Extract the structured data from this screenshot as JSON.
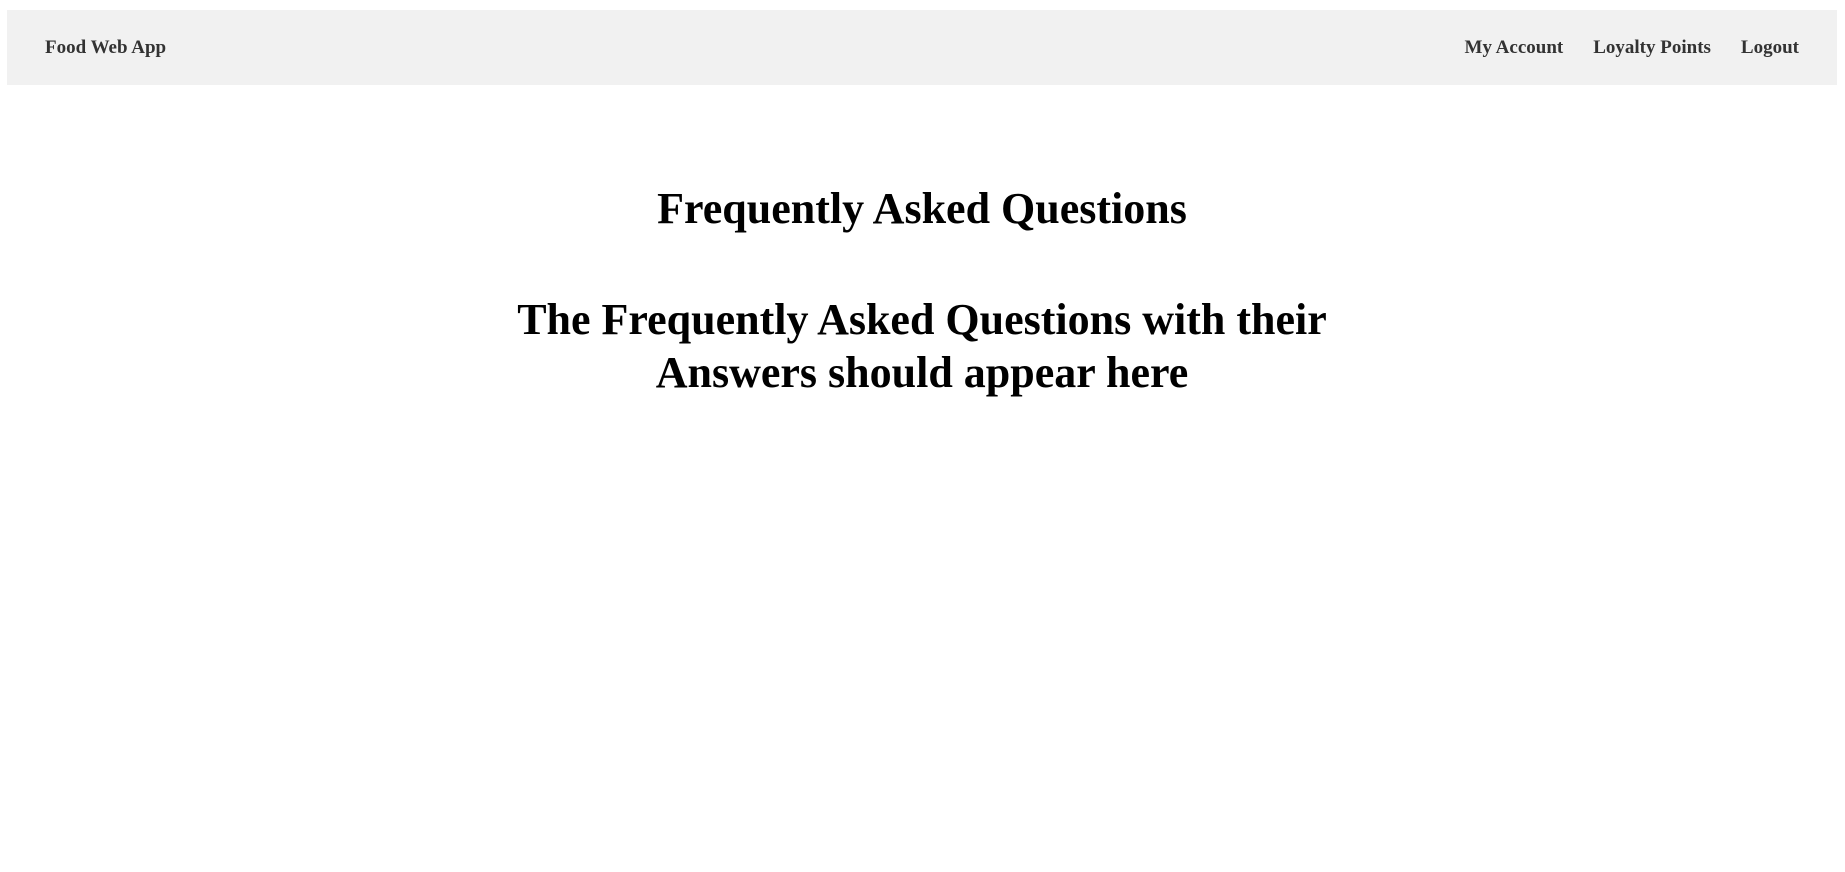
{
  "navbar": {
    "brand": "Food Web App",
    "links": [
      {
        "label": "My Account"
      },
      {
        "label": "Loyalty Points"
      },
      {
        "label": "Logout"
      }
    ]
  },
  "main": {
    "title": "Frequently Asked Questions",
    "placeholder": "The Frequently Asked Questions with their Answers should appear here"
  },
  "colors": {
    "navbar_background": "#f1f1f1",
    "nav_text": "#333333",
    "page_background": "#ffffff",
    "heading_text": "#000000"
  }
}
